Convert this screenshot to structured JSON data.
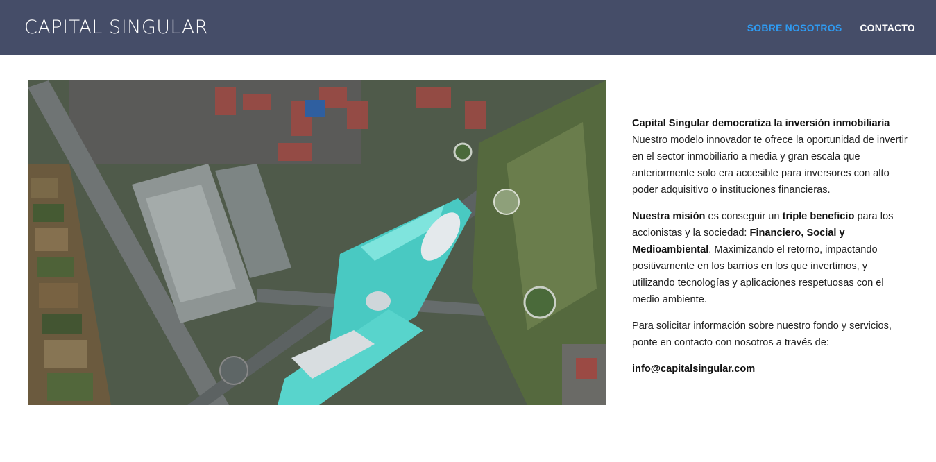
{
  "header": {
    "brand": "CAPITAL SINGULAR",
    "nav": [
      {
        "label": "SOBRE NOSOTROS",
        "active": true
      },
      {
        "label": "CONTACTO",
        "active": false
      }
    ]
  },
  "hero": {
    "alt": "aerial-city-view"
  },
  "content": {
    "p1_bold": "Capital Singular democratiza la inversión inmobiliaria",
    "p1_text": "Nuestro modelo innovador te ofrece la oportunidad de invertir en el sector inmobiliario a media y gran escala que anteriormente solo era accesible para inversores con alto poder adquisitivo o instituciones financieras.",
    "p2_a_bold": "Nuestra misión",
    "p2_b": " es conseguir un ",
    "p2_c_bold": "triple beneficio",
    "p2_d": " para los accionistas y la sociedad: ",
    "p2_e_bold": "Financiero, Social y Medioambiental",
    "p2_f": ". Maximizando el retorno, impactando positivamente en los barrios en los que invertimos, y utilizando tecnologías y aplicaciones respetuosas con el medio ambiente.",
    "p3_text": "Para solicitar información sobre nuestro fondo y servicios, ponte en contacto con nosotros a través de:",
    "email": "info@capitalsingular.com"
  },
  "colors": {
    "header_bg": "#454d68",
    "nav_active": "#2f9bf2",
    "nav_default": "#ffffff"
  }
}
